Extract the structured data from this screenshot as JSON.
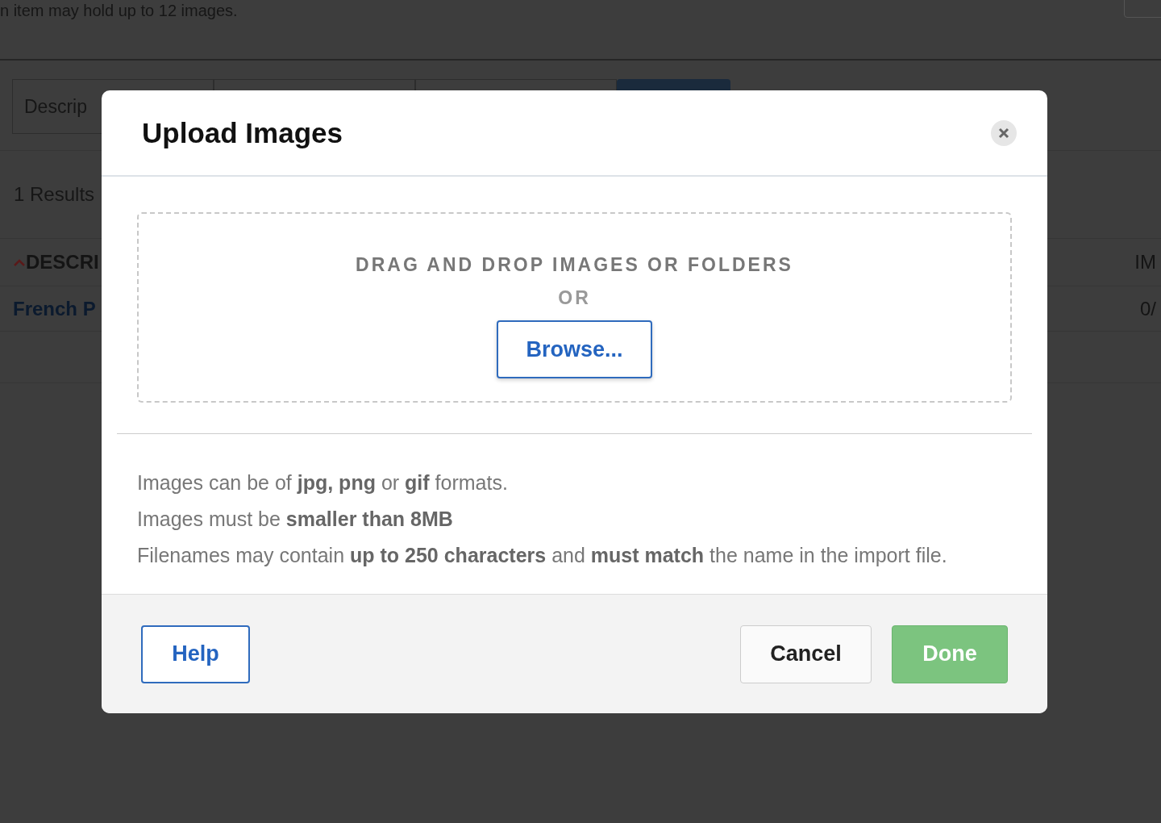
{
  "background": {
    "notice": "n item may hold up to 12 images.",
    "filter": {
      "placeholder": "Descrip"
    },
    "results": "1 Results",
    "table": {
      "columns": [
        {
          "label": "DESCRI",
          "sorted": true
        },
        {
          "label": "IM",
          "sorted": false
        }
      ],
      "rows": [
        [
          "French P",
          "0/"
        ]
      ]
    }
  },
  "dialog": {
    "title": "Upload Images",
    "dropzone": {
      "prompt": "DRAG AND DROP IMAGES OR FOLDERS",
      "or": "OR",
      "browse": "Browse..."
    },
    "notes": [
      "Images can be of **jpg, png** or **gif** formats.",
      "Images must be **smaller than 8MB**",
      "Filenames may contain **up to 250 characters** and **must match** the name in the import file."
    ],
    "buttons": [
      {
        "label": "Help",
        "kind": "link"
      },
      {
        "label": "Cancel",
        "kind": "secondary"
      },
      {
        "label": "Done",
        "kind": "primary"
      }
    ]
  }
}
